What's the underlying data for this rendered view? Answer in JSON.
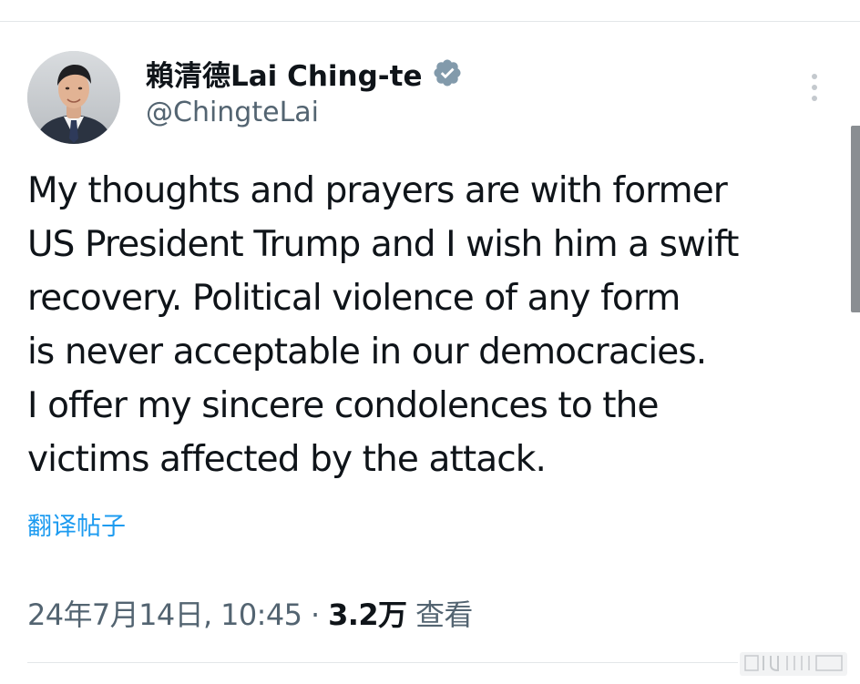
{
  "author": {
    "display_name": "賴清德Lai Ching-te",
    "handle": "@ChingteLai",
    "verified": true,
    "avatar_icon": "profile-photo"
  },
  "tweet": {
    "lines": [
      "My thoughts and prayers are with former",
      "US President Trump and I wish him a swift",
      "recovery. Political violence of any form",
      "is never acceptable in our democracies.",
      "I offer my sincere condolences to the",
      "victims affected by the attack."
    ],
    "translate_label": "翻译帖子"
  },
  "meta": {
    "timestamp": "24年7月14日, 10:45",
    "separator": "·",
    "views_count": "3.2万",
    "views_label": "查看"
  },
  "icons": {
    "more": "more-vertical-icon",
    "verified": "verified-badge-icon"
  },
  "colors": {
    "text_primary": "#0f1419",
    "text_secondary": "#536471",
    "link": "#1d9bf0",
    "verified_badge": "#829aab"
  }
}
